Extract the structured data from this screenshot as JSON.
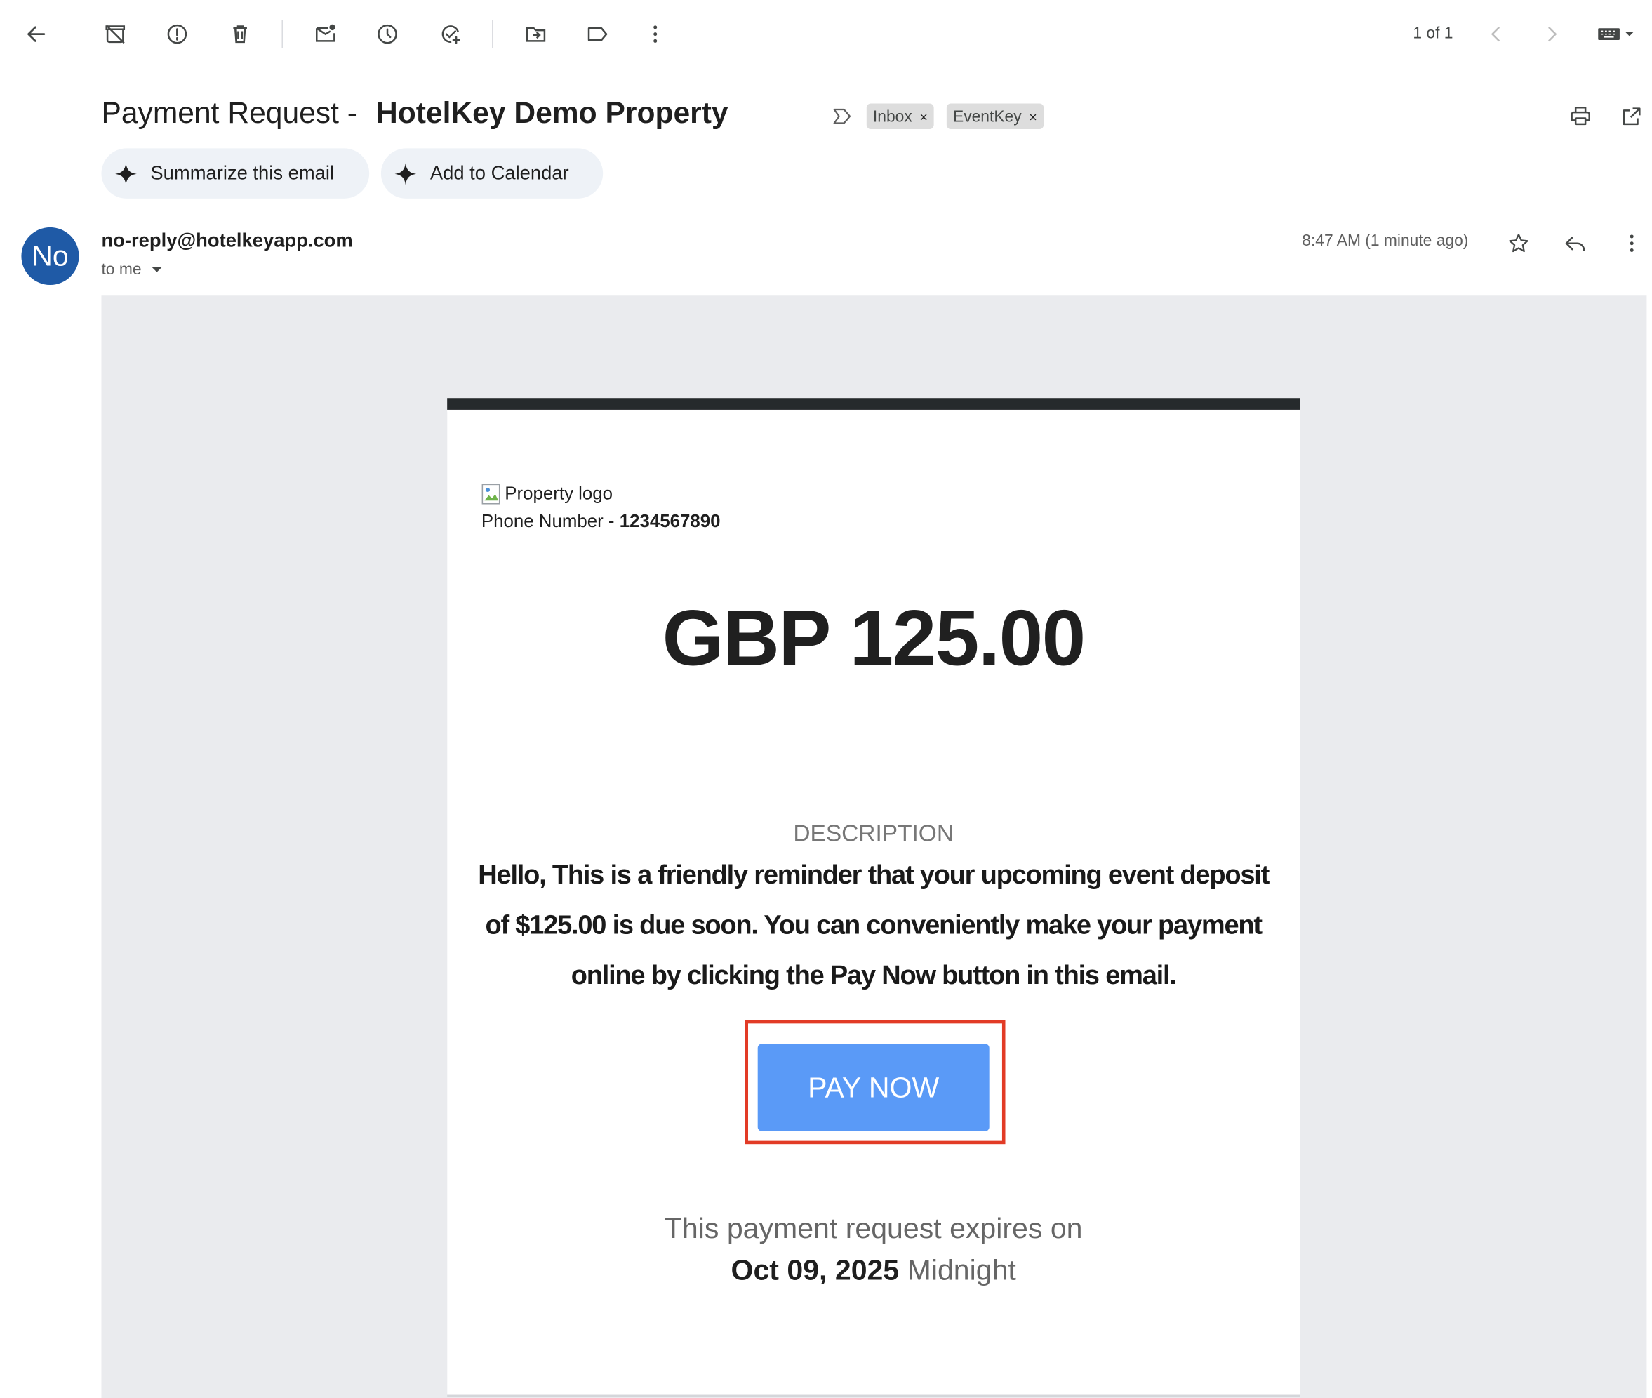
{
  "toolbar": {
    "pagination": "1 of 1",
    "icons": [
      "back-arrow-icon",
      "archive-icon",
      "report-spam-icon",
      "delete-icon",
      "mark-unread-icon",
      "snooze-icon",
      "add-to-tasks-icon",
      "move-to-icon",
      "labels-icon",
      "more-vert-icon",
      "chevron-left-icon",
      "chevron-right-icon",
      "keyboard-icon"
    ]
  },
  "subject": {
    "prefix": "Payment Request -",
    "title": "HotelKey Demo Property"
  },
  "labels": [
    {
      "name": "Inbox",
      "remove": "×"
    },
    {
      "name": "EventKey",
      "remove": "×"
    }
  ],
  "actions": {
    "summarize": "Summarize this email",
    "calendar": "Add to Calendar"
  },
  "message": {
    "avatar_initials": "No",
    "avatar_color": "#1f5aa6",
    "sender": "no-reply@hotelkeyapp.com",
    "recipient": "to me",
    "timestamp": "8:47 AM (1 minute ago)"
  },
  "email": {
    "logo_alt": "Property logo",
    "phone_label": "Phone Number - ",
    "phone_number": "1234567890",
    "amount": "GBP 125.00",
    "description_title": "DESCRIPTION",
    "description_body": "Hello, This is a friendly reminder that your upcoming event deposit of $125.00 is due soon. You can conveniently make your payment online by clicking the Pay Now button in this email.",
    "pay_button": "PAY NOW",
    "pay_button_color": "#5a9af7",
    "highlight_color": "#e23b26",
    "expires_text": "This payment request expires on",
    "expiry_date": "Oct 09, 2025",
    "expiry_time": " Midnight"
  }
}
